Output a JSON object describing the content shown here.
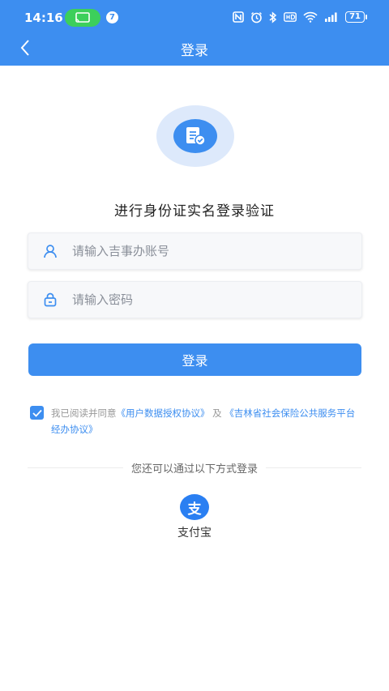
{
  "status_bar": {
    "time": "14:16",
    "notification_count": "7",
    "battery": "71",
    "icons": [
      "cast-icon",
      "nfc-icon",
      "alarm-icon",
      "bluetooth-icon",
      "hd-icon",
      "wifi-icon",
      "signal-icon",
      "battery-icon"
    ]
  },
  "header": {
    "title": "登录",
    "back_icon": "chevron-left-icon"
  },
  "page": {
    "logo_icon": "verified-document-icon",
    "subtitle": "进行身份证实名登录验证"
  },
  "form": {
    "account": {
      "placeholder": "请输入吉事办账号",
      "value": "",
      "icon": "user-icon"
    },
    "password": {
      "placeholder": "请输入密码",
      "value": "",
      "icon": "lock-icon"
    },
    "login_label": "登录"
  },
  "agreement": {
    "checked": true,
    "prefix": "我已阅读并同意",
    "link1": "《用户数据授权协议》",
    "connector": "及",
    "link2": "《吉林省社会保险公共服务平台经办协议》"
  },
  "alt_login": {
    "divider_text": "您还可以通过以下方式登录",
    "alipay_glyph": "支",
    "alipay_label": "支付宝"
  },
  "colors": {
    "primary": "#3d8ef0",
    "status_green": "#3ccf5b"
  }
}
